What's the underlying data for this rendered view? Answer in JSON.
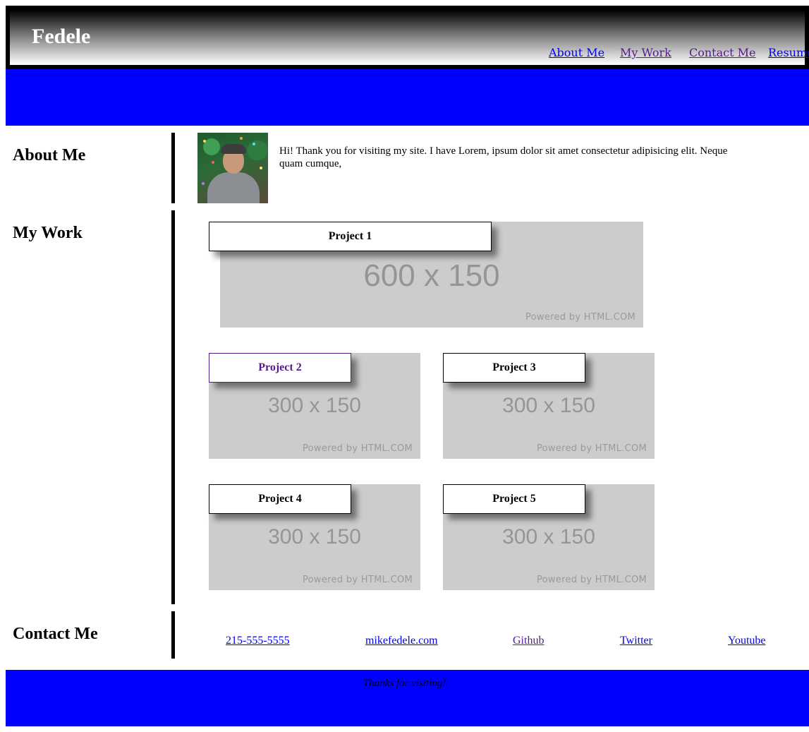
{
  "header": {
    "title": "Fedele",
    "nav": [
      "About Me",
      "My Work",
      "Contact Me",
      "Resume"
    ]
  },
  "about": {
    "heading": "About Me",
    "text": "Hi! Thank you for visiting my site. I have Lorem, ipsum dolor sit amet consectetur adipisicing elit. Neque quam cumque,"
  },
  "work": {
    "heading": "My Work",
    "projects": [
      {
        "label": "Project 1",
        "image_size": "600 x 150",
        "image_credit": "Powered by HTML.COM"
      },
      {
        "label": "Project 2",
        "image_size": "300 x 150",
        "image_credit": "Powered by HTML.COM"
      },
      {
        "label": "Project 3",
        "image_size": "300 x 150",
        "image_credit": "Powered by HTML.COM"
      },
      {
        "label": "Project 4",
        "image_size": "300 x 150",
        "image_credit": "Powered by HTML.COM"
      },
      {
        "label": "Project 5",
        "image_size": "300 x 150",
        "image_credit": "Powered by HTML.COM"
      }
    ]
  },
  "contact": {
    "heading": "Contact Me",
    "links": [
      "215-555-5555",
      "mikefedele.com",
      "Github",
      "Twitter",
      "Youtube"
    ]
  },
  "footer": {
    "text": "Thanks for visiting!"
  },
  "colors": {
    "banner_blue": "#0000ff",
    "link_unvisited": "#0000ee",
    "link_visited": "#551a8b",
    "placeholder_gray": "#cccccc"
  }
}
